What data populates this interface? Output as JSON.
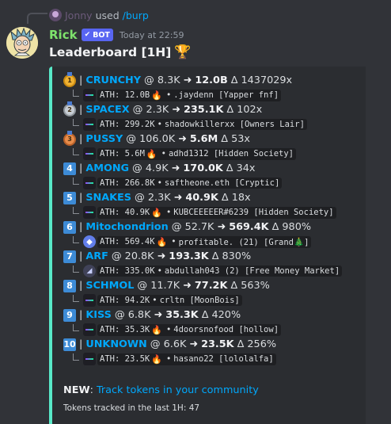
{
  "reply": {
    "username": "Jonny",
    "used_text": "used",
    "command": "/burp"
  },
  "author": {
    "name": "Rick",
    "bot_tag": "BOT",
    "timestamp": "Today at 22:59"
  },
  "message": {
    "title": "Leaderboard [1H]",
    "title_icon": "trophy-icon"
  },
  "embed": {
    "accent_color": "#58e8c8"
  },
  "entries": [
    {
      "rank": "1",
      "badge": "gold",
      "token": "CRUNCHY",
      "at": "@ 8.3K",
      "to": "12.0B",
      "delta": "Δ 1437029x",
      "chain": "solana",
      "ath_label": "ATH:",
      "ath": "12.0B",
      "fire": true,
      "caller": ".jaydenn [Yapper fnf]"
    },
    {
      "rank": "2",
      "badge": "silver",
      "token": "SPACEX",
      "at": "@ 2.3K",
      "to": "235.1K",
      "delta": "Δ 102x",
      "chain": "solana",
      "ath_label": "ATH:",
      "ath": "299.2K",
      "fire": false,
      "caller": "shadowkillerxx [Owners Lair]"
    },
    {
      "rank": "3",
      "badge": "bronze",
      "token": "PUSSY",
      "at": "@ 106.0K",
      "to": "5.6M",
      "delta": "Δ 53x",
      "chain": "solana",
      "ath_label": "ATH:",
      "ath": "5.6M",
      "fire": true,
      "caller": "adhd1312 [Hidden Society]"
    },
    {
      "rank": "4",
      "badge": "box",
      "token": "AMONG",
      "at": "@ 4.9K",
      "to": "170.0K",
      "delta": "Δ 34x",
      "chain": "solana",
      "ath_label": "ATH:",
      "ath": "266.8K",
      "fire": false,
      "caller": "saftheone.eth [Cryptic]"
    },
    {
      "rank": "5",
      "badge": "box",
      "token": "SNAKES",
      "at": "@ 2.3K",
      "to": "40.9K",
      "delta": "Δ 18x",
      "chain": "solana",
      "ath_label": "ATH:",
      "ath": "40.9K",
      "fire": true,
      "caller": "KUBCEEEEER#6239 [Hidden Society]"
    },
    {
      "rank": "6",
      "badge": "box",
      "token": "Mitochondrion",
      "at": "@ 52.7K",
      "to": "569.4K",
      "delta": "Δ 980%",
      "chain": "ethereum",
      "ath_label": "ATH:",
      "ath": "569.4K",
      "fire": true,
      "caller": "profitable. (21) [Grand🎄]"
    },
    {
      "rank": "7",
      "badge": "box",
      "token": "ARF",
      "at": "@ 20.8K",
      "to": "193.3K",
      "delta": "Δ 830%",
      "chain": "base",
      "ath_label": "ATH:",
      "ath": "335.0K",
      "fire": false,
      "caller": "abdullah043 (2) [Free Money Market]"
    },
    {
      "rank": "8",
      "badge": "box",
      "token": "SCHMOL",
      "at": "@ 11.7K",
      "to": "77.2K",
      "delta": "Δ 563%",
      "chain": "solana",
      "ath_label": "ATH:",
      "ath": "94.2K",
      "fire": false,
      "caller": "crltn [MoonBois]"
    },
    {
      "rank": "9",
      "badge": "box",
      "token": "KISS",
      "at": "@ 6.8K",
      "to": "35.3K",
      "delta": "Δ 420%",
      "chain": "solana",
      "ath_label": "ATH:",
      "ath": "35.3K",
      "fire": true,
      "caller": "4doorsnofood [hollow]"
    },
    {
      "rank": "10",
      "badge": "box",
      "token": "UNKNOWN",
      "at": "@ 6.6K",
      "to": "23.5K",
      "delta": "Δ 256%",
      "chain": "solana",
      "ath_label": "ATH:",
      "ath": "23.5K",
      "fire": true,
      "caller": "hasano22 [lololalfa]"
    }
  ],
  "footer": {
    "new_label": "NEW",
    "new_sep": ":",
    "link_text": "Track tokens in your community",
    "tracked_text": "Tokens tracked in the last 1H: 47"
  }
}
